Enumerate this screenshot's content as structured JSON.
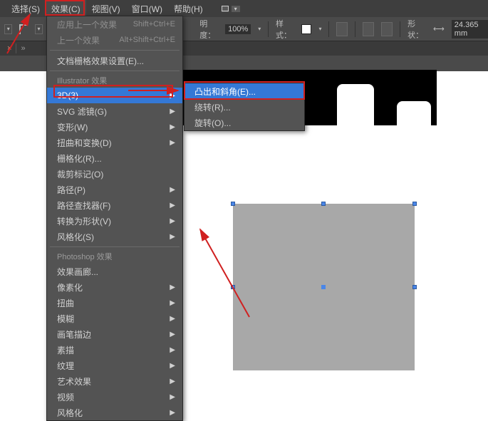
{
  "menubar": {
    "select": "选择(S)",
    "effect": "效果(C)",
    "view": "视图(V)",
    "window": "窗口(W)",
    "help": "帮助(H)"
  },
  "toolbar": {
    "opacity_label": "明度：",
    "opacity_value": "100%",
    "style_label": "样式：",
    "shape_label": "形状：",
    "shape_value": "24.365 mm"
  },
  "mainmenu": {
    "apply_last": "应用上一个效果",
    "apply_last_key": "Shift+Ctrl+E",
    "last": "上一个效果",
    "last_key": "Alt+Shift+Ctrl+E",
    "doc_raster": "文档栅格效果设置(E)...",
    "header_ai": "Illustrator 效果",
    "threeD": "3D(3)",
    "svg": "SVG 滤镜(G)",
    "warp": "变形(W)",
    "distort": "扭曲和变换(D)",
    "rasterize": "栅格化(R)...",
    "crop": "裁剪标记(O)",
    "path": "路径(P)",
    "pathfinder": "路径查找器(F)",
    "convert": "转换为形状(V)",
    "stylize": "风格化(S)",
    "header_ps": "Photoshop 效果",
    "gallery": "效果画廊...",
    "pixelate": "像素化",
    "ps_distort": "扭曲",
    "blur": "模糊",
    "brush": "画笔描边",
    "sketch": "素描",
    "texture": "纹理",
    "artistic": "艺术效果",
    "video": "视频",
    "ps_stylize": "风格化"
  },
  "submenu": {
    "extrude": "凸出和斜角(E)...",
    "revolve": "绕转(R)...",
    "rotate": "旋转(O)..."
  },
  "tab": {
    "close": "×",
    "arrow": "»"
  }
}
